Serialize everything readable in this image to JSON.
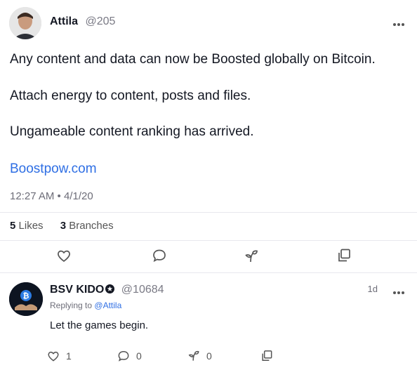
{
  "post": {
    "author_name": "Attila",
    "author_handle": "@205",
    "lines": [
      "Any content and data can now be Boosted globally on Bitcoin.",
      "Attach energy to content, posts and files.",
      "Ungameable content ranking has arrived."
    ],
    "link": "Boostpow.com",
    "timestamp": "12:27 AM • 4/1/20",
    "likes_count": "5",
    "likes_label": "Likes",
    "branches_count": "3",
    "branches_label": "Branches",
    "actions": [
      "heart-icon",
      "comment-icon",
      "branch-icon",
      "copy-icon"
    ]
  },
  "reply": {
    "author_name": "BSV KIDO",
    "author_handle": "@10684",
    "time": "1d",
    "replying_prefix": "Replying to",
    "replying_to": "@Attila",
    "text": "Let the games begin.",
    "likes": "1",
    "comments": "0",
    "branches": "0"
  },
  "colors": {
    "accent": "#2f6fe4",
    "text": "#141823",
    "muted": "#6d6d78",
    "divider": "#e8e8ee"
  }
}
